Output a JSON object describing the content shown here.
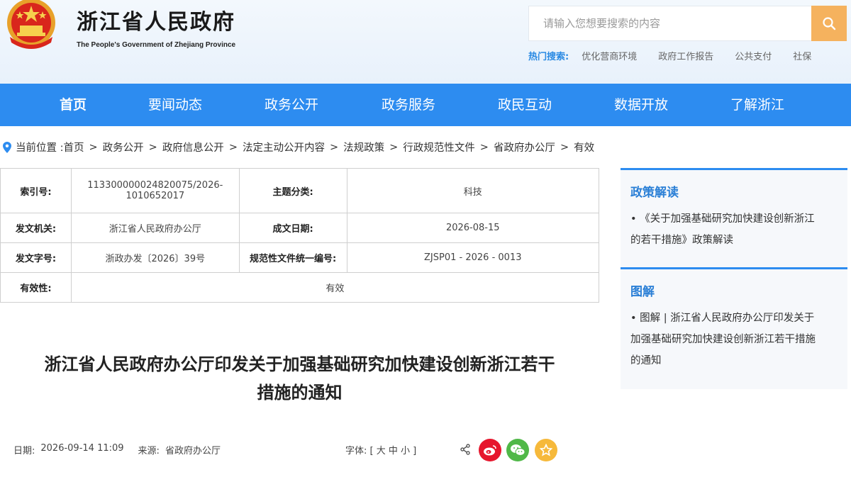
{
  "header": {
    "title": "浙江省人民政府",
    "subtitle": "The People's Government of Zhejiang Province",
    "search_placeholder": "请输入您想要搜索的内容",
    "hot_label": "热门搜索:",
    "hot_items": [
      "优化营商环境",
      "政府工作报告",
      "公共支付",
      "社保"
    ]
  },
  "nav": [
    "首页",
    "要闻动态",
    "政务公开",
    "政务服务",
    "政民互动",
    "数据开放",
    "了解浙江"
  ],
  "breadcrumb": {
    "prefix": "当前位置 :",
    "items": [
      "首页",
      "政务公开",
      "政府信息公开",
      "法定主动公开内容",
      "法规政策",
      "行政规范性文件",
      "省政府办公厅",
      "有效"
    ]
  },
  "info": {
    "index_label": "索引号:",
    "index_value_1": "113300000024820075/2026-",
    "index_value_2": "1010652017",
    "subject_label": "主题分类:",
    "subject_value": "科技",
    "issuer_label": "发文机关:",
    "issuer_value": "浙江省人民政府办公厅",
    "date_label": "成文日期:",
    "date_value": "2026-08-15",
    "docno_label": "发文字号:",
    "docno_value": "浙政办发〔2026〕39号",
    "unified_label": "规范性文件统一编号:",
    "unified_value": "ZJSP01 - 2026 - 0013",
    "validity_label": "有效性:",
    "validity_value": "有效"
  },
  "article": {
    "title_line1": "浙江省人民政府办公厅印发关于加强基础研究加快建设创新浙江若干",
    "title_line2": "措施的通知",
    "date_label": "日期:",
    "date": "2026-09-14 11:09",
    "source_label": "来源:",
    "source": "省政府办公厅",
    "font_label": "字体:",
    "font_options": "[ 大 中 小 ]"
  },
  "sidebar": {
    "policy_title": "政策解读",
    "policy_line1": "• 《关于加强基础研究加快建设创新浙江",
    "policy_line2": "的若干措施》政策解读",
    "graphic_title": "图解",
    "graphic_line1": "• 图解 | 浙江省人民政府办公厅印发关于",
    "graphic_line2": "加强基础研究加快建设创新浙江若干措施",
    "graphic_line3": "的通知"
  },
  "colors": {
    "nav_blue": "#2d8cf0",
    "search_orange": "#f5b25e",
    "weibo": "#e6162d",
    "wechat": "#50b848",
    "favorite": "#f6b93b"
  },
  "icons": [
    "national-emblem-icon",
    "search-icon",
    "location-pin-icon",
    "share-icon",
    "weibo-icon",
    "wechat-icon",
    "star-icon"
  ]
}
